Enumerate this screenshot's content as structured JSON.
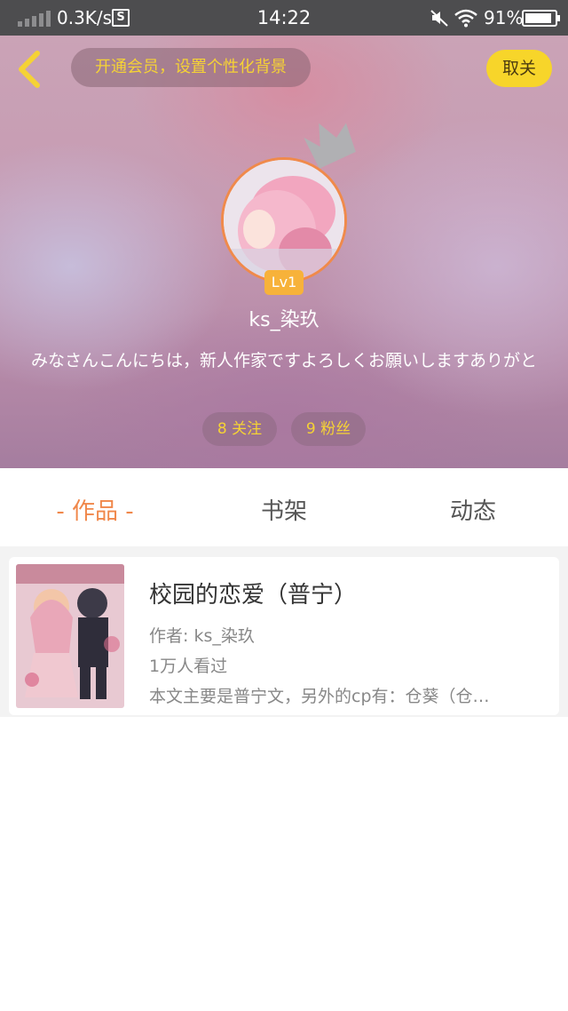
{
  "status_bar": {
    "network_speed": "0.3K/s",
    "sim_icon": "S",
    "time": "14:22",
    "battery_percent": "91%",
    "icons": [
      "signal-icon",
      "sim-icon",
      "mute-icon",
      "wifi-icon",
      "battery-icon"
    ]
  },
  "header": {
    "back_icon": "chevron-left-icon",
    "vip_promo": "开通会员，设置个性化背景",
    "unfollow_label": "取关",
    "level": "Lv1",
    "username": "ks_染玖",
    "bio": "みなさんこんにちは，新人作家ですよろしくお願いしますありがと",
    "following": "8 关注",
    "fans": "9 粉丝",
    "colors": {
      "accent_yellow": "#f7d52a",
      "avatar_ring": "#f08a4b",
      "level_badge": "#f7b23a"
    }
  },
  "tabs": {
    "works": "- 作品 -",
    "shelf": "书架",
    "feed": "动态",
    "active": "works",
    "active_color": "#f0874a"
  },
  "books": [
    {
      "title": "校园的恋爱（普宁）",
      "author": "作者: ks_染玖",
      "views": "1万人看过",
      "description": "本文主要是普宁文，另外的cp有：仓葵（仓…"
    }
  ]
}
